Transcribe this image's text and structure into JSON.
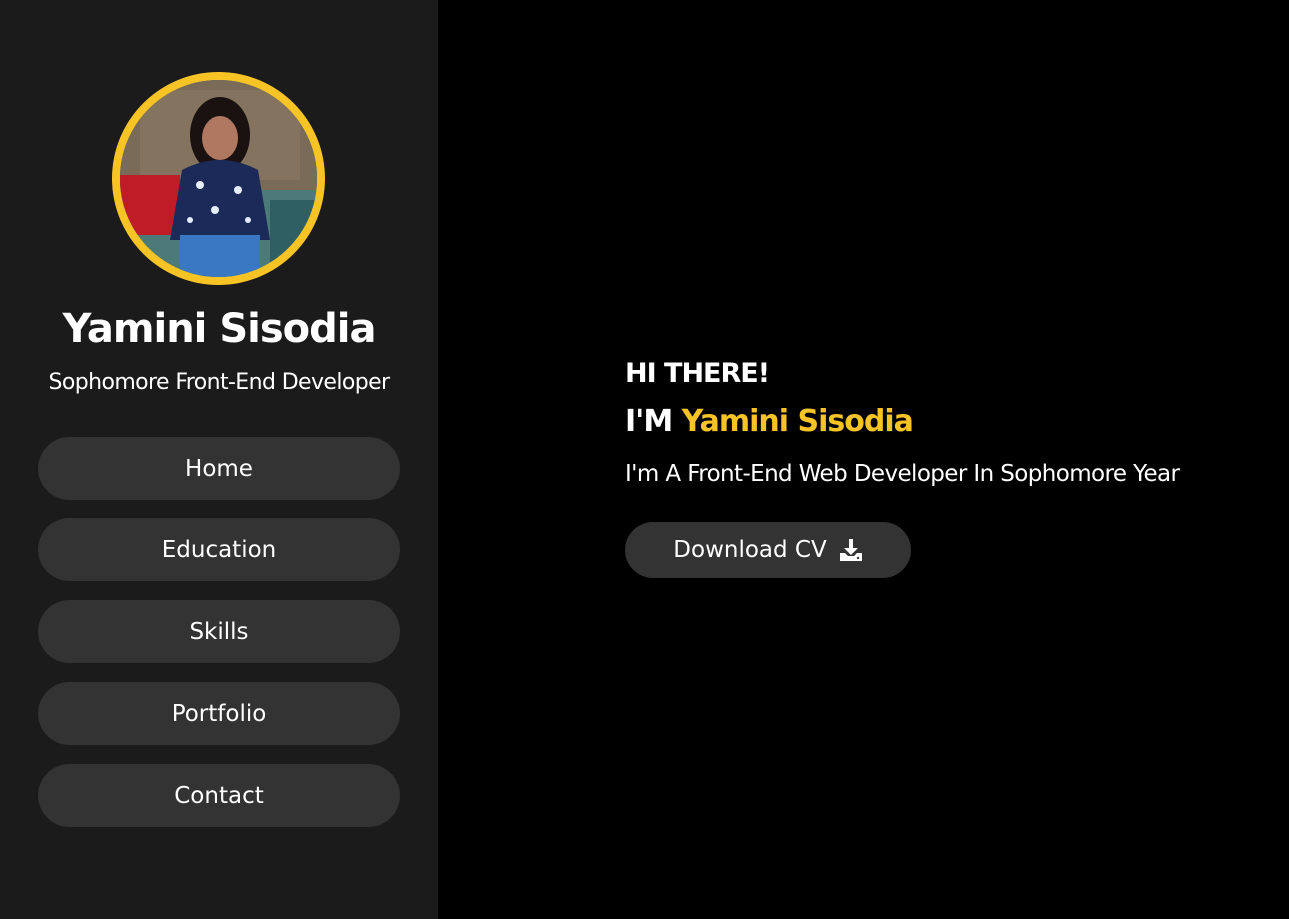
{
  "profile": {
    "name": "Yamini Sisodia",
    "role": "Sophomore Front-End Developer",
    "avatar_ring_color": "#f7c325"
  },
  "nav": {
    "items": [
      {
        "label": "Home"
      },
      {
        "label": "Education"
      },
      {
        "label": "Skills"
      },
      {
        "label": "Portfolio"
      },
      {
        "label": "Contact"
      }
    ]
  },
  "hero": {
    "greeting": "HI THERE!",
    "intro_prefix": "I'M ",
    "intro_name": "Yamini Sisodia",
    "tagline": "I'm A Front-End Web Developer In Sophomore Year",
    "cv_button_label": "Download CV",
    "cv_icon": "download-icon",
    "accent_color": "#f7c325"
  }
}
